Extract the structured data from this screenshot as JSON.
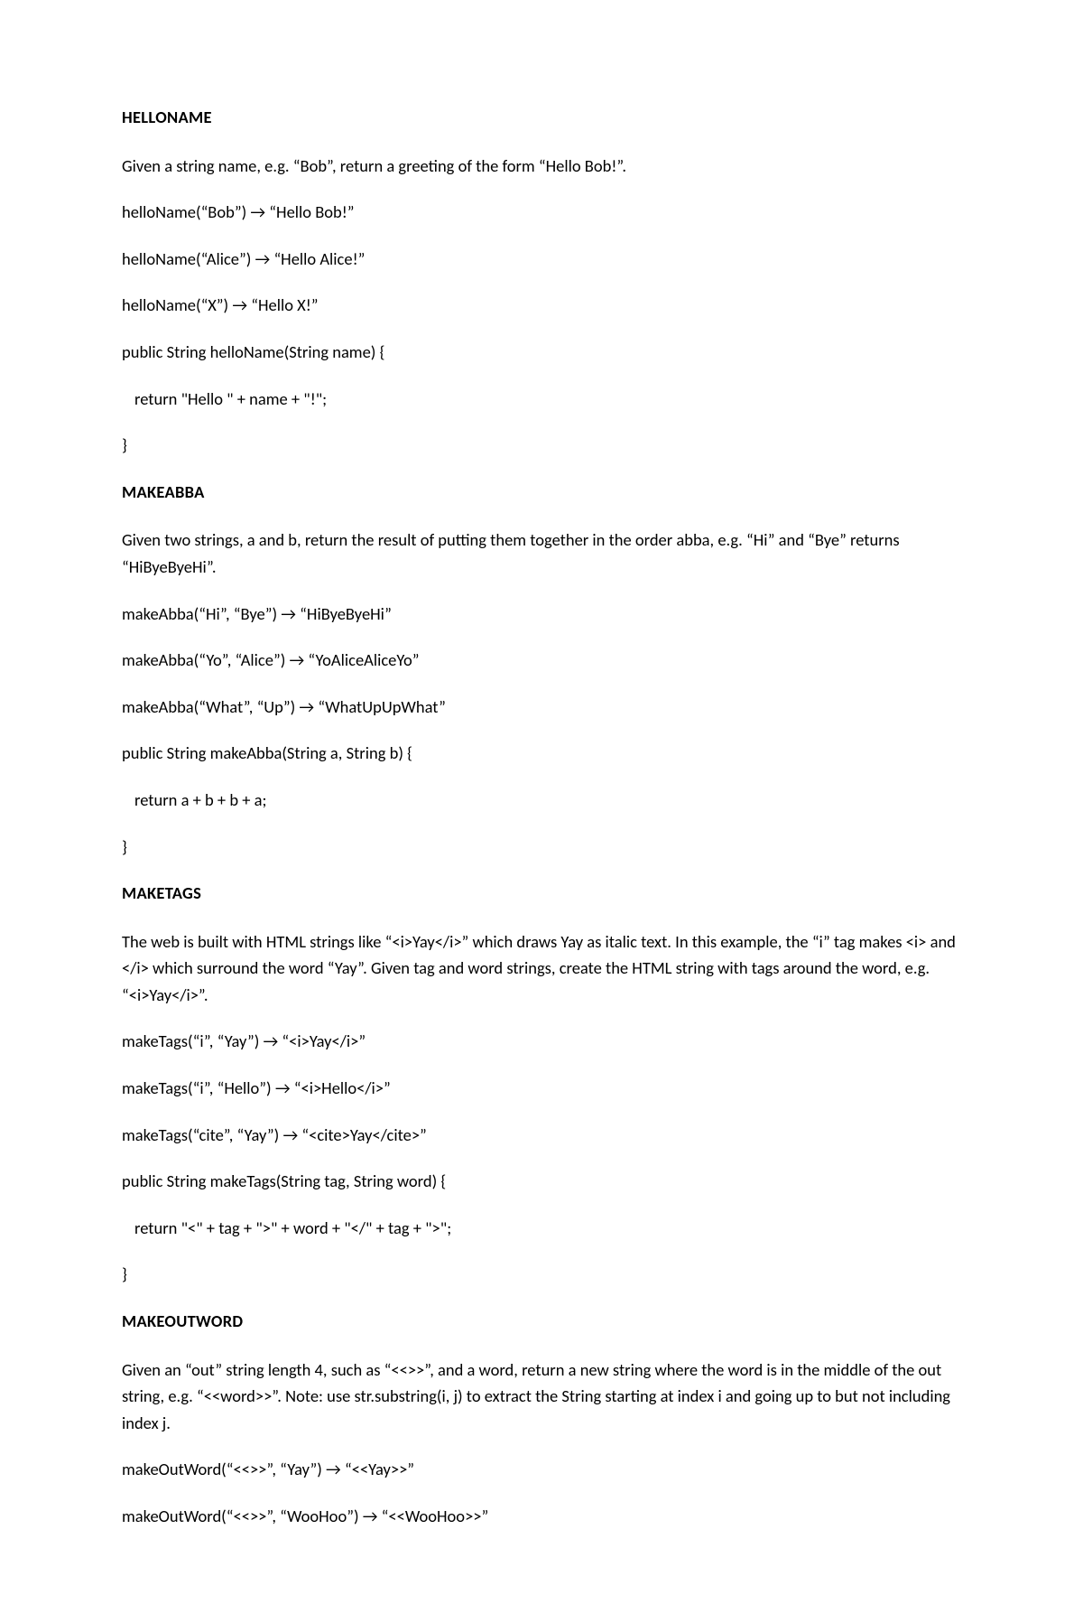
{
  "sections": [
    {
      "title": "HELLONAME",
      "description": "Given a string name, e.g. “Bob”, return a greeting of the form “Hello Bob!”.",
      "examples": [
        "helloName(“Bob”) → “Hello Bob!”",
        "helloName(“Alice”) → “Hello Alice!”",
        "helloName(“X”) → “Hello X!”"
      ],
      "code": [
        "public String helloName(String name) {",
        "  return \"Hello \" + name + \"!\";",
        "}"
      ]
    },
    {
      "title": "MAKEABBA",
      "description": "Given two strings, a and b, return the result of putting them together in the order abba, e.g. “Hi” and “Bye” returns “HiByeByeHi”.",
      "examples": [
        "makeAbba(“Hi”, “Bye”) → “HiByeByeHi”",
        "makeAbba(“Yo”, “Alice”) → “YoAliceAliceYo”",
        "makeAbba(“What”, “Up”) → “WhatUpUpWhat”"
      ],
      "code": [
        "public String makeAbba(String a, String b) {",
        "  return a + b + b + a;",
        "}"
      ]
    },
    {
      "title": "MAKETAGS",
      "description": "The web is built with HTML strings like “<i>Yay</i>” which draws Yay as italic text. In this example, the “i” tag makes <i> and </i> which surround the word “Yay”. Given tag and word strings, create the HTML string with tags around the word, e.g. “<i>Yay</i>”.",
      "examples": [
        "makeTags(“i”, “Yay”) → “<i>Yay</i>”",
        "makeTags(“i”, “Hello”) → “<i>Hello</i>”",
        "makeTags(“cite”, “Yay”) → “<cite>Yay</cite>”"
      ],
      "code": [
        "public String makeTags(String tag, String word) {",
        "  return \"<\" + tag + \">\" + word + \"</\" + tag + \">\";",
        "}"
      ]
    },
    {
      "title": "MAKEOUTWORD",
      "description": "Given an “out” string length 4, such as “<<>>”, and a word, return a new string where the word is in the middle of the out string, e.g. “<<word>>”. Note: use str.substring(i, j) to extract the String starting at index i and going up to but not including index j.",
      "examples": [
        "makeOutWord(“<<>>”, “Yay”) → “<<Yay>>”",
        "makeOutWord(“<<>>”, “WooHoo”) → “<<WooHoo>>”"
      ],
      "code": []
    }
  ]
}
